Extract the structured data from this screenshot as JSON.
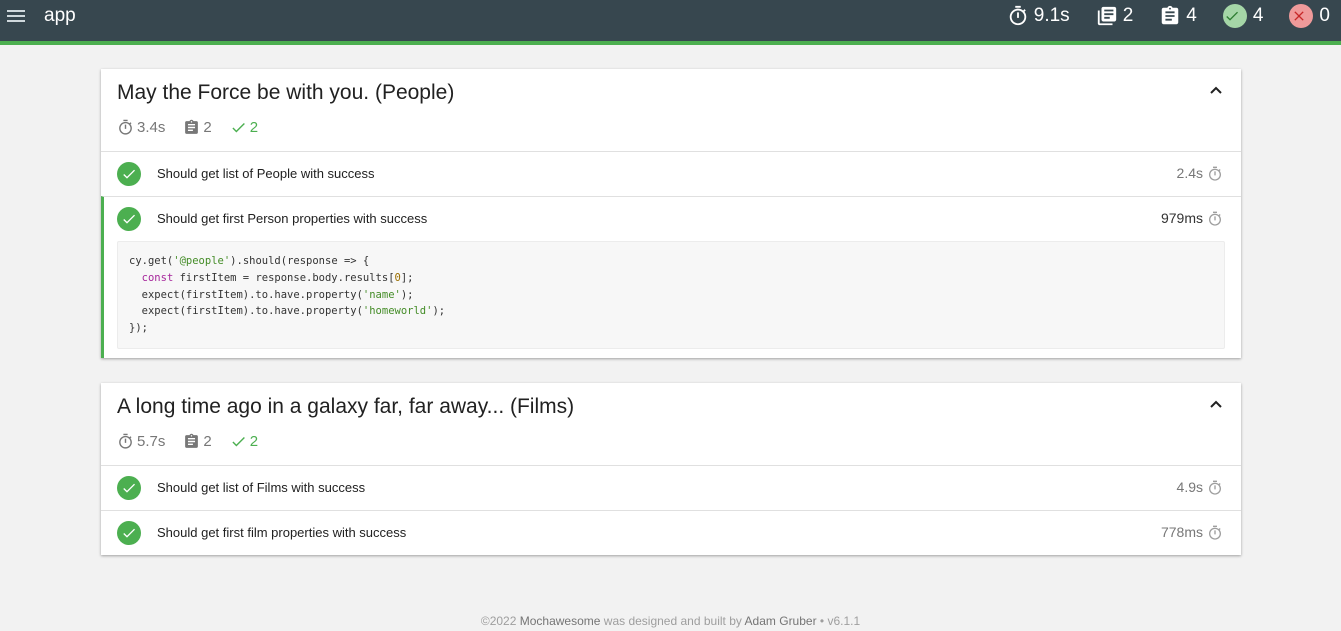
{
  "app": {
    "title": "app"
  },
  "stats": {
    "duration": "9.1s",
    "suites": "2",
    "tests": "4",
    "passes": "4",
    "failures": "0"
  },
  "suites": [
    {
      "title": "May the Force be with you. (People)",
      "duration": "3.4s",
      "tests_count": "2",
      "passes": "2",
      "tests": [
        {
          "title": "Should get list of People with success",
          "duration": "2.4s"
        },
        {
          "title": "Should get first Person properties with success",
          "duration": "979ms",
          "code": {
            "l1a": "cy.get(",
            "l1b": "'@people'",
            "l1c": ").should(response => {",
            "l2a": "  ",
            "l2b": "const",
            "l2c": " firstItem = response.body.results[",
            "l2d": "0",
            "l2e": "];",
            "l3a": "  expect(firstItem).to.have.property(",
            "l3b": "'name'",
            "l3c": ");",
            "l4a": "  expect(firstItem).to.have.property(",
            "l4b": "'homeworld'",
            "l4c": ");",
            "l5": "});"
          }
        }
      ]
    },
    {
      "title": "A long time ago in a galaxy far, far away... (Films)",
      "duration": "5.7s",
      "tests_count": "2",
      "passes": "2",
      "tests": [
        {
          "title": "Should get list of Films with success",
          "duration": "4.9s"
        },
        {
          "title": "Should get first film properties with success",
          "duration": "778ms"
        }
      ]
    }
  ],
  "footer": {
    "copyright": "©2022 ",
    "brand": "Mochawesome",
    "middle": " was designed and built by ",
    "author": "Adam Gruber",
    "version": " • v6.1.1"
  },
  "colors": {
    "navbar": "#37474f",
    "pass": "#4caf50",
    "fail": "#ef9a9a"
  },
  "icons": [
    "menu-icon",
    "stopwatch-icon",
    "library-books-icon",
    "assignment-icon",
    "check-circle-icon",
    "cancel-circle-icon",
    "chevron-up-icon",
    "check-icon"
  ]
}
